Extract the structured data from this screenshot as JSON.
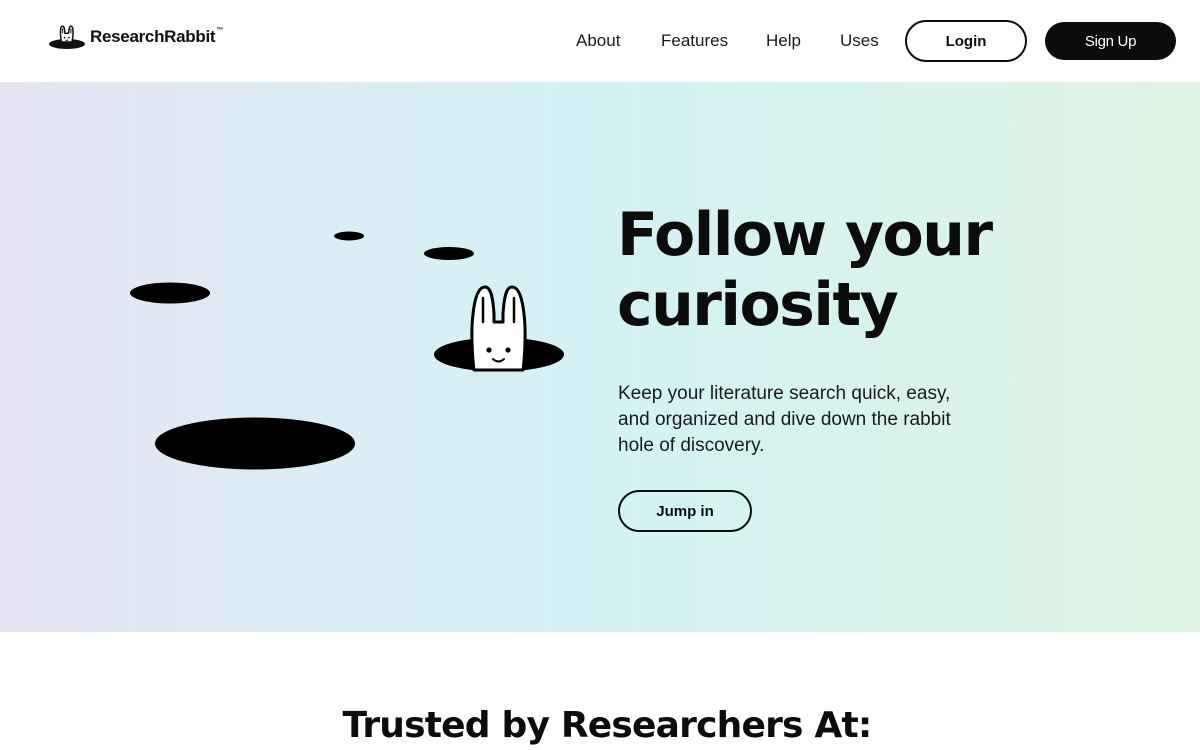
{
  "brand": {
    "name": "ResearchRabbit",
    "trademark": "™",
    "logo_icon": "rabbit-in-hole-icon"
  },
  "nav": {
    "items": [
      {
        "label": "About"
      },
      {
        "label": "Features"
      },
      {
        "label": "Help"
      },
      {
        "label": "Uses"
      }
    ],
    "login_label": "Login",
    "signup_label": "Sign Up"
  },
  "hero": {
    "headline": "Follow your curiosity",
    "subtext": "Keep your literature search quick, easy, and organized and dive down the rabbit hole of discovery.",
    "cta_label": "Jump in",
    "illustration": "rabbit-peeking-from-hole-icon"
  },
  "trusted": {
    "title": "Trusted by Researchers At:"
  },
  "colors": {
    "text": "#0c0c0c",
    "button_dark": "#0c0c0c",
    "hero_gradient_start": "#e6e4f3",
    "hero_gradient_mid": "#d4f2f5",
    "hero_gradient_end": "#e0f5e3",
    "background": "#ffffff"
  }
}
